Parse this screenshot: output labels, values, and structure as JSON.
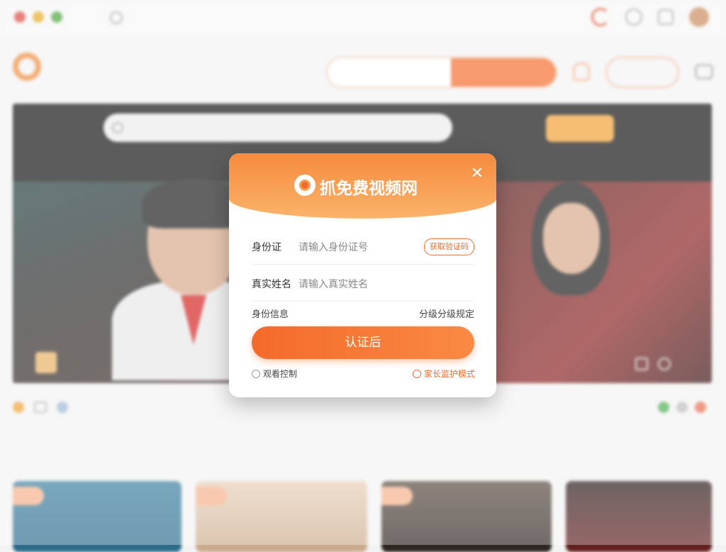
{
  "window": {
    "location_text": "",
    "right_items": [
      "",
      "",
      ""
    ]
  },
  "site": {
    "name": "",
    "menu_label": "",
    "search_placeholder": "",
    "search_button": "",
    "login_label": ""
  },
  "player": {
    "brand": "",
    "search_placeholder": "",
    "action_button": "",
    "tabs": [
      "",
      "",
      ""
    ],
    "overlay_title": "",
    "overlay_subtitle": "",
    "thumb_caption": ""
  },
  "below": {
    "section_title": "",
    "more_label": ""
  },
  "modal": {
    "title": "抓免费视频网",
    "close_label": "✕",
    "row1_label": "身份证",
    "row1_placeholder": "请输入身份证号",
    "row1_badge": "获取验证码",
    "row2_label": "真实姓名",
    "row2_placeholder": "请输入真实姓名",
    "info_label": "身份信息",
    "info_right": "分级分级规定",
    "submit_label": "认证后",
    "option_left": "观看控制",
    "option_right": "家长监护模式"
  },
  "colors": {
    "accent": "#f46a2a",
    "header_gradient_start": "#f58a3e",
    "header_gradient_end": "#fbb46a"
  },
  "icons": [
    "close-icon",
    "logo-icon",
    "radio-icon",
    "search-icon",
    "bell-icon",
    "menu-icon"
  ]
}
